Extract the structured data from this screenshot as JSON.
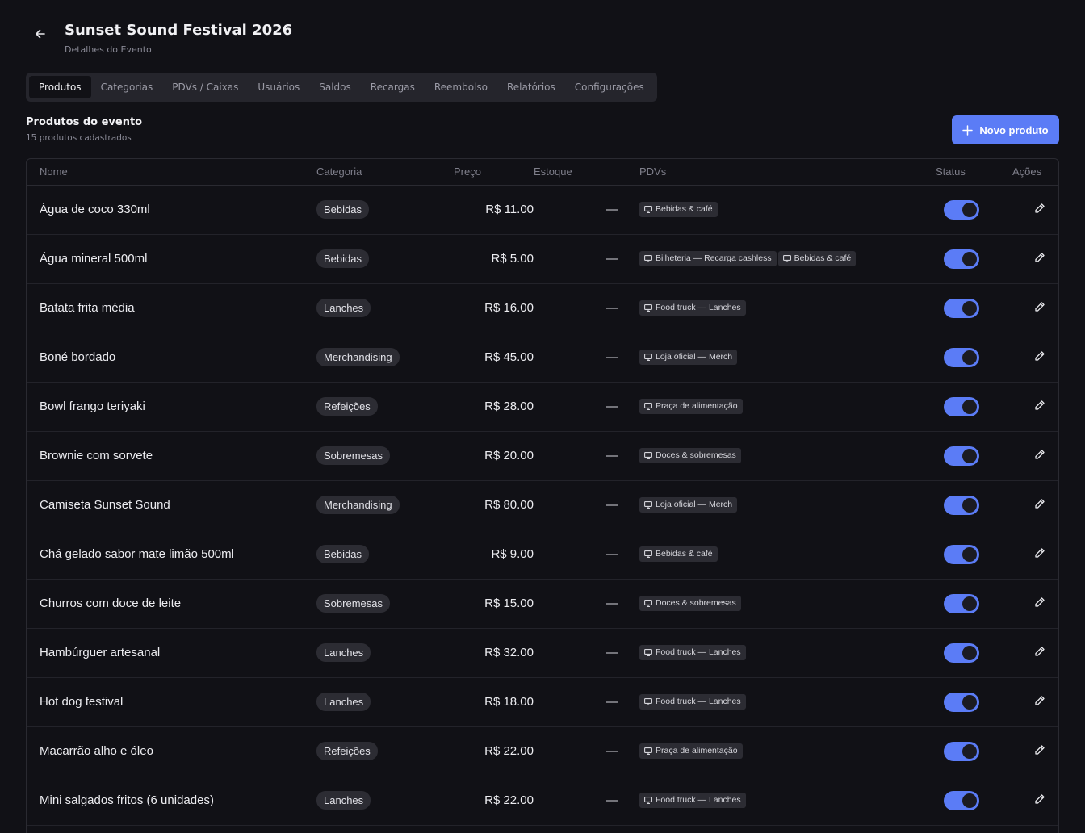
{
  "header": {
    "title": "Sunset Sound Festival 2026",
    "subtitle": "Detalhes do Evento",
    "back_icon": "arrow-left-icon"
  },
  "tabs": [
    {
      "label": "Produtos",
      "active": true
    },
    {
      "label": "Categorias",
      "active": false
    },
    {
      "label": "PDVs / Caixas",
      "active": false
    },
    {
      "label": "Usuários",
      "active": false
    },
    {
      "label": "Saldos",
      "active": false
    },
    {
      "label": "Recargas",
      "active": false
    },
    {
      "label": "Reembolso",
      "active": false
    },
    {
      "label": "Relatórios",
      "active": false
    },
    {
      "label": "Configurações",
      "active": false
    }
  ],
  "section": {
    "title": "Produtos do evento",
    "subtitle": "15 produtos cadastrados",
    "new_button_label": "Novo produto"
  },
  "table": {
    "columns": [
      "Nome",
      "Categoria",
      "Preço",
      "Estoque",
      "PDVs",
      "Status",
      "Ações"
    ],
    "rows": [
      {
        "name": "Água de coco 330ml",
        "category": "Bebidas",
        "price": "R$ 11.00",
        "stock": "—",
        "pdvs": [
          "Bebidas & café"
        ],
        "status": true
      },
      {
        "name": "Água mineral 500ml",
        "category": "Bebidas",
        "price": "R$ 5.00",
        "stock": "—",
        "pdvs": [
          "Bilheteria — Recarga cashless",
          "Bebidas & café"
        ],
        "status": true
      },
      {
        "name": "Batata frita média",
        "category": "Lanches",
        "price": "R$ 16.00",
        "stock": "—",
        "pdvs": [
          "Food truck — Lanches"
        ],
        "status": true
      },
      {
        "name": "Boné bordado",
        "category": "Merchandising",
        "price": "R$ 45.00",
        "stock": "—",
        "pdvs": [
          "Loja oficial — Merch"
        ],
        "status": true
      },
      {
        "name": "Bowl frango teriyaki",
        "category": "Refeições",
        "price": "R$ 28.00",
        "stock": "—",
        "pdvs": [
          "Praça de alimentação"
        ],
        "status": true
      },
      {
        "name": "Brownie com sorvete",
        "category": "Sobremesas",
        "price": "R$ 20.00",
        "stock": "—",
        "pdvs": [
          "Doces & sobremesas"
        ],
        "status": true
      },
      {
        "name": "Camiseta Sunset Sound",
        "category": "Merchandising",
        "price": "R$ 80.00",
        "stock": "—",
        "pdvs": [
          "Loja oficial — Merch"
        ],
        "status": true
      },
      {
        "name": "Chá gelado sabor mate limão 500ml",
        "category": "Bebidas",
        "price": "R$ 9.00",
        "stock": "—",
        "pdvs": [
          "Bebidas & café"
        ],
        "status": true
      },
      {
        "name": "Churros com doce de leite",
        "category": "Sobremesas",
        "price": "R$ 15.00",
        "stock": "—",
        "pdvs": [
          "Doces & sobremesas"
        ],
        "status": true
      },
      {
        "name": "Hambúrguer artesanal",
        "category": "Lanches",
        "price": "R$ 32.00",
        "stock": "—",
        "pdvs": [
          "Food truck — Lanches"
        ],
        "status": true
      },
      {
        "name": "Hot dog festival",
        "category": "Lanches",
        "price": "R$ 18.00",
        "stock": "—",
        "pdvs": [
          "Food truck — Lanches"
        ],
        "status": true
      },
      {
        "name": "Macarrão alho e óleo",
        "category": "Refeições",
        "price": "R$ 22.00",
        "stock": "—",
        "pdvs": [
          "Praça de alimentação"
        ],
        "status": true
      },
      {
        "name": "Mini salgados fritos (6 unidades)",
        "category": "Lanches",
        "price": "R$ 22.00",
        "stock": "—",
        "pdvs": [
          "Food truck — Lanches"
        ],
        "status": true
      }
    ]
  },
  "icons": {
    "back": "arrow-left-icon",
    "plus": "plus-icon",
    "pdv": "monitor-icon",
    "edit": "pencil-icon"
  },
  "colors": {
    "accent": "#5b7cf6",
    "background": "#111116"
  }
}
